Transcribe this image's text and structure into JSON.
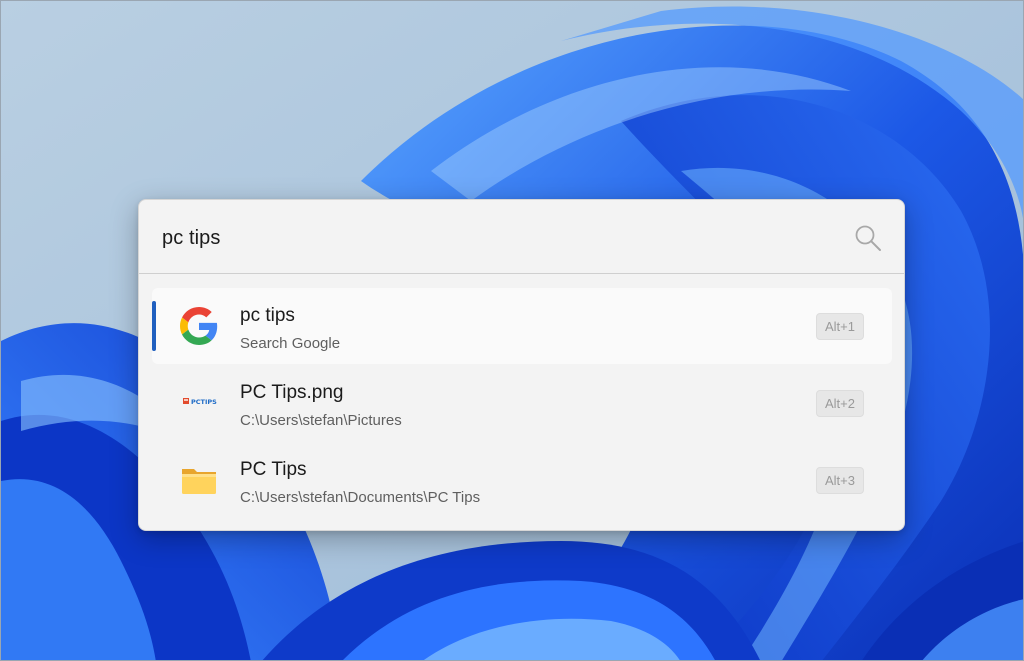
{
  "search": {
    "query": "pc tips",
    "icon": "search-icon"
  },
  "results": [
    {
      "title": "pc tips",
      "subtitle": "Search Google",
      "shortcut": "Alt+1",
      "icon": "google-icon",
      "selected": true
    },
    {
      "title": "PC Tips.png",
      "subtitle": "C:\\Users\\stefan\\Pictures",
      "shortcut": "Alt+2",
      "icon": "image-file-icon",
      "icon_text": "PCTIPS",
      "selected": false
    },
    {
      "title": "PC Tips",
      "subtitle": "C:\\Users\\stefan\\Documents\\PC Tips",
      "shortcut": "Alt+3",
      "icon": "folder-icon",
      "selected": false
    }
  ],
  "colors": {
    "accent": "#1f5fbf",
    "panel_background": "#f3f3f3",
    "wallpaper_blue": "#1a52e0"
  }
}
